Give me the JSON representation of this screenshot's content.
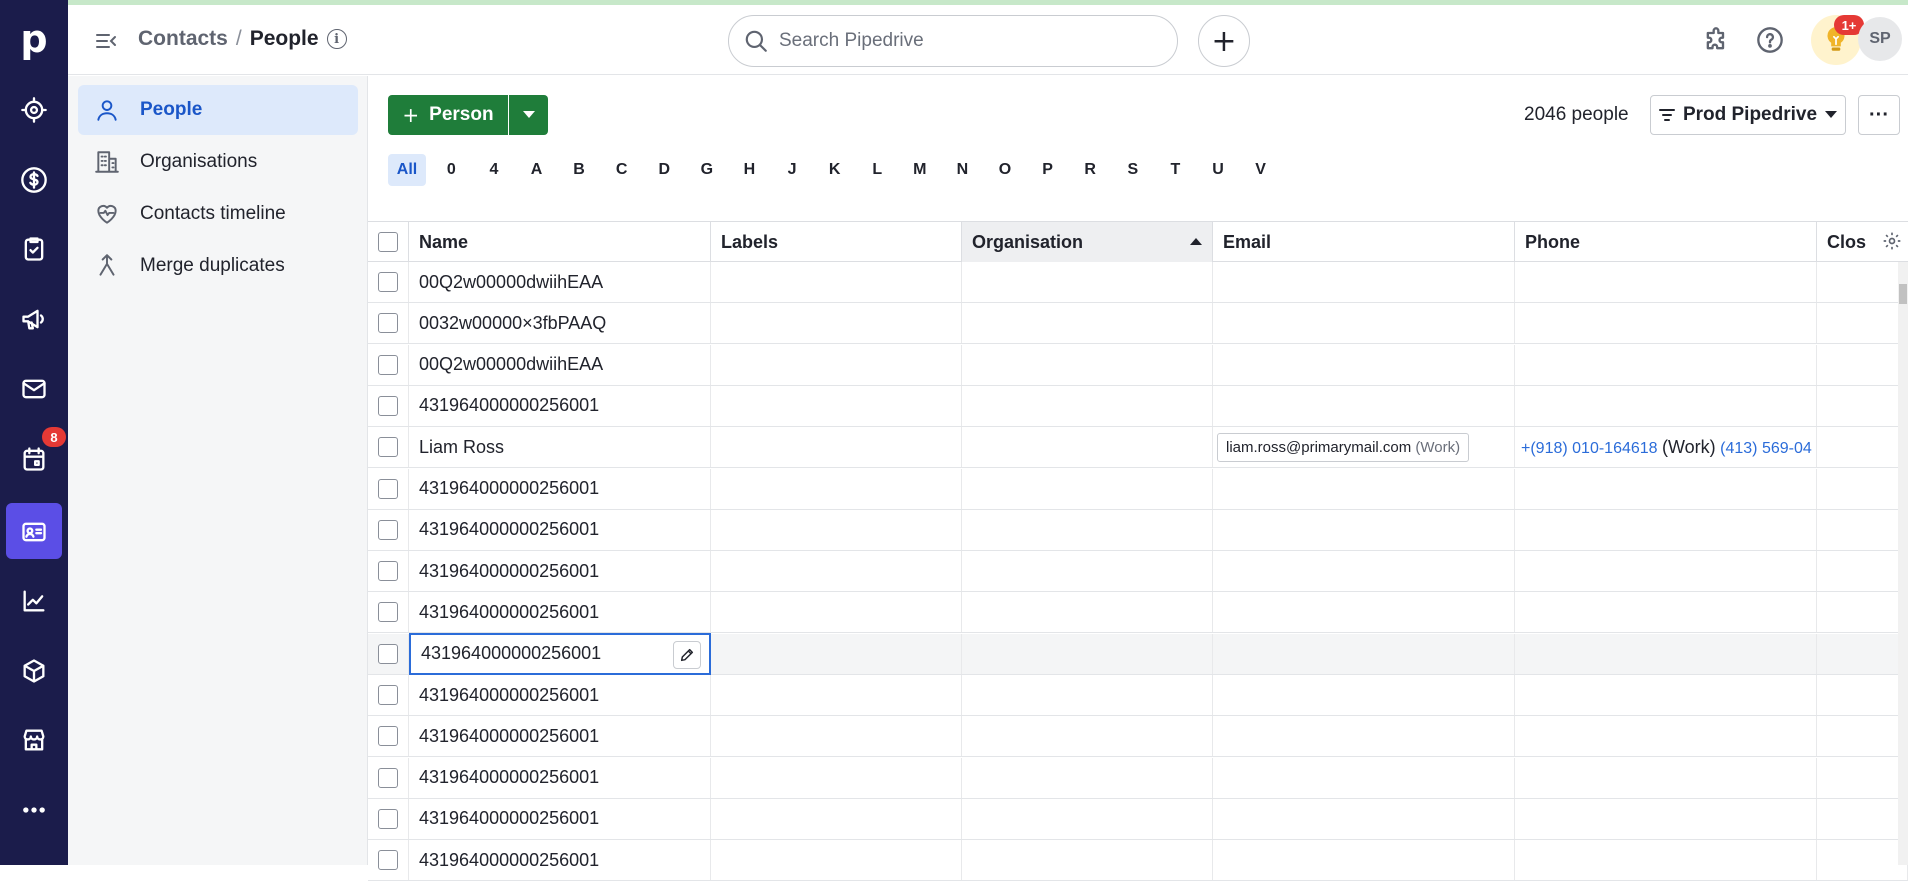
{
  "rail": {
    "logo": "p",
    "items": [
      {
        "name": "focus",
        "icon": "target-icon"
      },
      {
        "name": "deals",
        "icon": "dollar-icon"
      },
      {
        "name": "projects",
        "icon": "clipboard-icon"
      },
      {
        "name": "campaigns",
        "icon": "megaphone-icon"
      },
      {
        "name": "mail",
        "icon": "mail-icon"
      },
      {
        "name": "activities",
        "icon": "calendar-icon"
      },
      {
        "name": "contacts",
        "icon": "contact-card-icon"
      },
      {
        "name": "insights",
        "icon": "chart-icon"
      },
      {
        "name": "products",
        "icon": "box-icon"
      },
      {
        "name": "marketplace",
        "icon": "store-icon"
      },
      {
        "name": "more",
        "icon": "more-icon"
      }
    ],
    "activities_badge": "8",
    "active_color": "#5b4ee6",
    "bg_color": "#1b1c4b"
  },
  "header": {
    "breadcrumb_parent": "Contacts",
    "breadcrumb_sep": "/",
    "breadcrumb_current": "People",
    "search_placeholder": "Search Pipedrive",
    "plus_label": "+",
    "bulb_badge": "1+",
    "avatar_initials": "SP"
  },
  "subnav": {
    "items": [
      {
        "label": "People",
        "icon": "person-icon",
        "active": true
      },
      {
        "label": "Organisations",
        "icon": "building-icon",
        "active": false
      },
      {
        "label": "Contacts timeline",
        "icon": "heart-pulse-icon",
        "active": false
      },
      {
        "label": "Merge duplicates",
        "icon": "merge-icon",
        "active": false
      }
    ]
  },
  "toolbar": {
    "add_label": "Person",
    "count": "2046 people",
    "filter_label": "Prod Pipedrive",
    "more_label": "···",
    "brand_green": "#1f7d3a"
  },
  "alphabet": [
    "All",
    "0",
    "4",
    "A",
    "B",
    "C",
    "D",
    "G",
    "H",
    "J",
    "K",
    "L",
    "M",
    "N",
    "O",
    "P",
    "R",
    "S",
    "T",
    "U",
    "V"
  ],
  "table": {
    "columns": [
      "Name",
      "Labels",
      "Organisation",
      "Email",
      "Phone",
      "Clos"
    ],
    "sorted_column": "Organisation",
    "rows": [
      {
        "name": "00Q2w00000dwiihEAA",
        "email": "",
        "email_tag": "",
        "phone": "",
        "phone_tag": "",
        "phone2": ""
      },
      {
        "name": "0032w00000×3fbPAAQ",
        "email": "",
        "email_tag": "",
        "phone": "",
        "phone_tag": "",
        "phone2": ""
      },
      {
        "name": "00Q2w00000dwiihEAA",
        "email": "",
        "email_tag": "",
        "phone": "",
        "phone_tag": "",
        "phone2": ""
      },
      {
        "name": "431964000000256001",
        "email": "",
        "email_tag": "",
        "phone": "",
        "phone_tag": "",
        "phone2": ""
      },
      {
        "name": "Liam Ross",
        "email": "liam.ross@primarymail.com",
        "email_tag": "(Work)",
        "phone": "+(918) 010-164618",
        "phone_tag": "(Work)",
        "phone2": "(413) 569-04"
      },
      {
        "name": "431964000000256001",
        "email": "",
        "email_tag": "",
        "phone": "",
        "phone_tag": "",
        "phone2": ""
      },
      {
        "name": "431964000000256001",
        "email": "",
        "email_tag": "",
        "phone": "",
        "phone_tag": "",
        "phone2": ""
      },
      {
        "name": "431964000000256001",
        "email": "",
        "email_tag": "",
        "phone": "",
        "phone_tag": "",
        "phone2": ""
      },
      {
        "name": "431964000000256001",
        "email": "",
        "email_tag": "",
        "phone": "",
        "phone_tag": "",
        "phone2": ""
      },
      {
        "name": "431964000000256001",
        "email": "",
        "email_tag": "",
        "phone": "",
        "phone_tag": "",
        "phone2": "",
        "editing": true
      },
      {
        "name": "431964000000256001",
        "email": "",
        "email_tag": "",
        "phone": "",
        "phone_tag": "",
        "phone2": ""
      },
      {
        "name": "431964000000256001",
        "email": "",
        "email_tag": "",
        "phone": "",
        "phone_tag": "",
        "phone2": ""
      },
      {
        "name": "431964000000256001",
        "email": "",
        "email_tag": "",
        "phone": "",
        "phone_tag": "",
        "phone2": ""
      },
      {
        "name": "431964000000256001",
        "email": "",
        "email_tag": "",
        "phone": "",
        "phone_tag": "",
        "phone2": ""
      },
      {
        "name": "431964000000256001",
        "email": "",
        "email_tag": "",
        "phone": "",
        "phone_tag": "",
        "phone2": ""
      }
    ]
  }
}
